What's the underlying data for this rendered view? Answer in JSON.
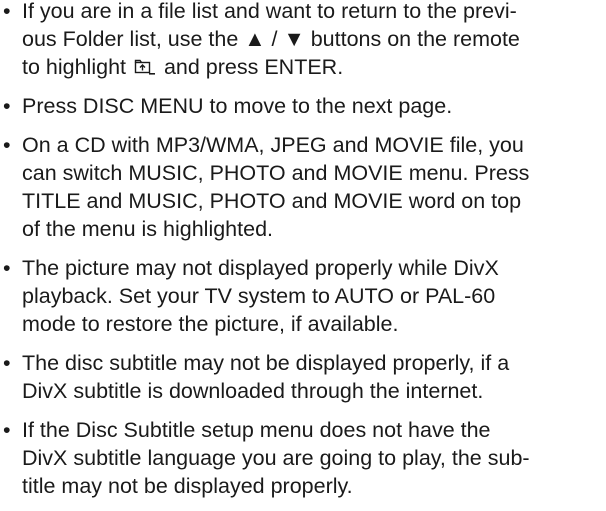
{
  "bullet_char": "•",
  "notes": [
    {
      "lines": [
        "If you are in a file list and want to return to the previ-",
        "ous Folder list, use the ▲ / ▼ buttons on the remote"
      ],
      "last_before_icon": "to highlight ",
      "icon": "folder-up-icon",
      "last_after_icon": " and press ENTER."
    },
    {
      "lines": [
        "Press DISC MENU to move to the next page."
      ]
    },
    {
      "lines": [
        "On a CD with MP3/WMA, JPEG and MOVIE file, you",
        "can switch MUSIC, PHOTO and MOVIE menu. Press",
        "TITLE and MUSIC, PHOTO and MOVIE word on top",
        "of the menu is highlighted."
      ]
    },
    {
      "lines": [
        "The picture may not displayed properly while DivX",
        "playback. Set your TV system to AUTO or PAL-60",
        "mode to restore the picture, if available."
      ]
    },
    {
      "lines": [
        "The disc subtitle may not be displayed properly, if a",
        "DivX subtitle is downloaded through the internet."
      ]
    },
    {
      "lines": [
        "If the Disc Subtitle setup menu does not have the",
        "DivX subtitle language you are going to play, the sub-",
        "title may not be displayed properly."
      ]
    }
  ]
}
